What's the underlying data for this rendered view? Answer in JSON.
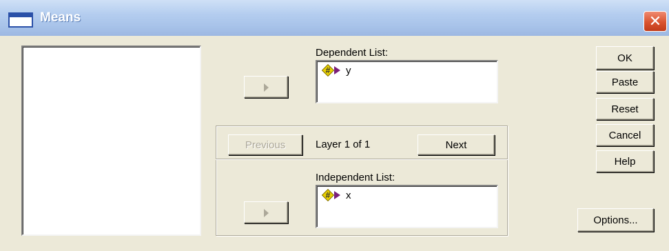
{
  "window": {
    "title": "Means",
    "close_glyph": "✕"
  },
  "source_list": {
    "items": []
  },
  "dependent": {
    "label": "Dependent List:",
    "items": [
      {
        "icon": "scale-variable-icon",
        "name": "y"
      }
    ]
  },
  "independent": {
    "label": "Independent List:",
    "items": [
      {
        "icon": "scale-variable-icon",
        "name": "x"
      }
    ]
  },
  "layer": {
    "previous_label": "Previous",
    "status": "Layer 1 of 1",
    "next_label": "Next"
  },
  "buttons": {
    "ok": "OK",
    "paste": "Paste",
    "reset": "Reset",
    "cancel": "Cancel",
    "help": "Help",
    "options": "Options..."
  }
}
